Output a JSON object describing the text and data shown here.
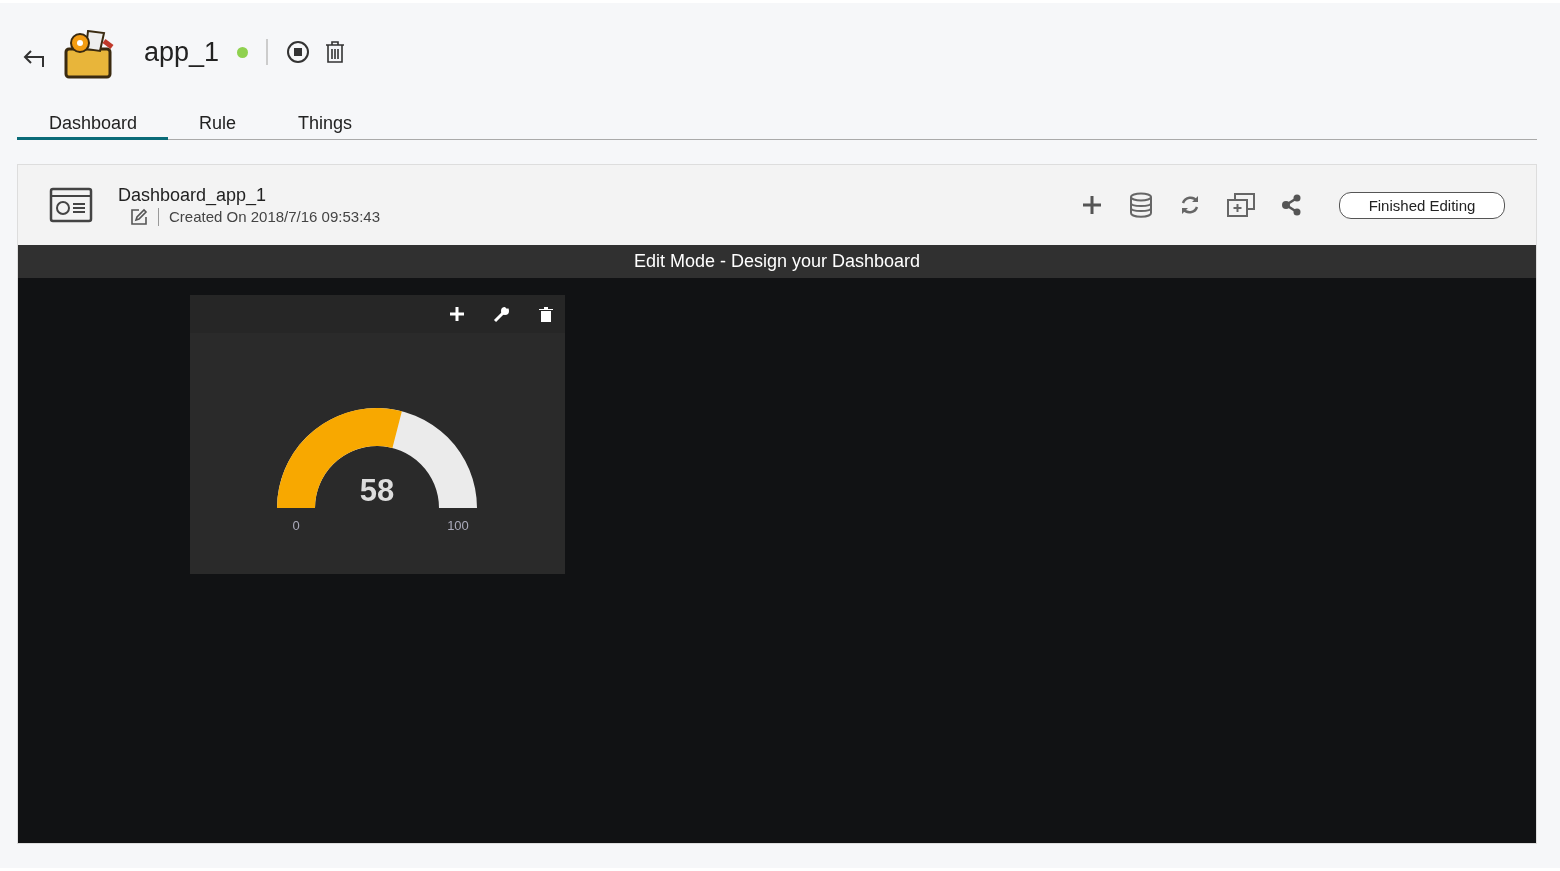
{
  "app": {
    "name": "app_1",
    "running": true
  },
  "tabs": [
    {
      "label": "Dashboard",
      "selected": true
    },
    {
      "label": "Rule",
      "selected": false
    },
    {
      "label": "Things",
      "selected": false
    }
  ],
  "dashboard": {
    "name": "Dashboard_app_1",
    "created": "Created On 2018/7/16 09:53:43",
    "finish_button": "Finished Editing"
  },
  "banner": "Edit Mode - Design your Dashboard",
  "widget": {
    "value": "58",
    "level": 0.58,
    "min": "0",
    "max": "100"
  }
}
